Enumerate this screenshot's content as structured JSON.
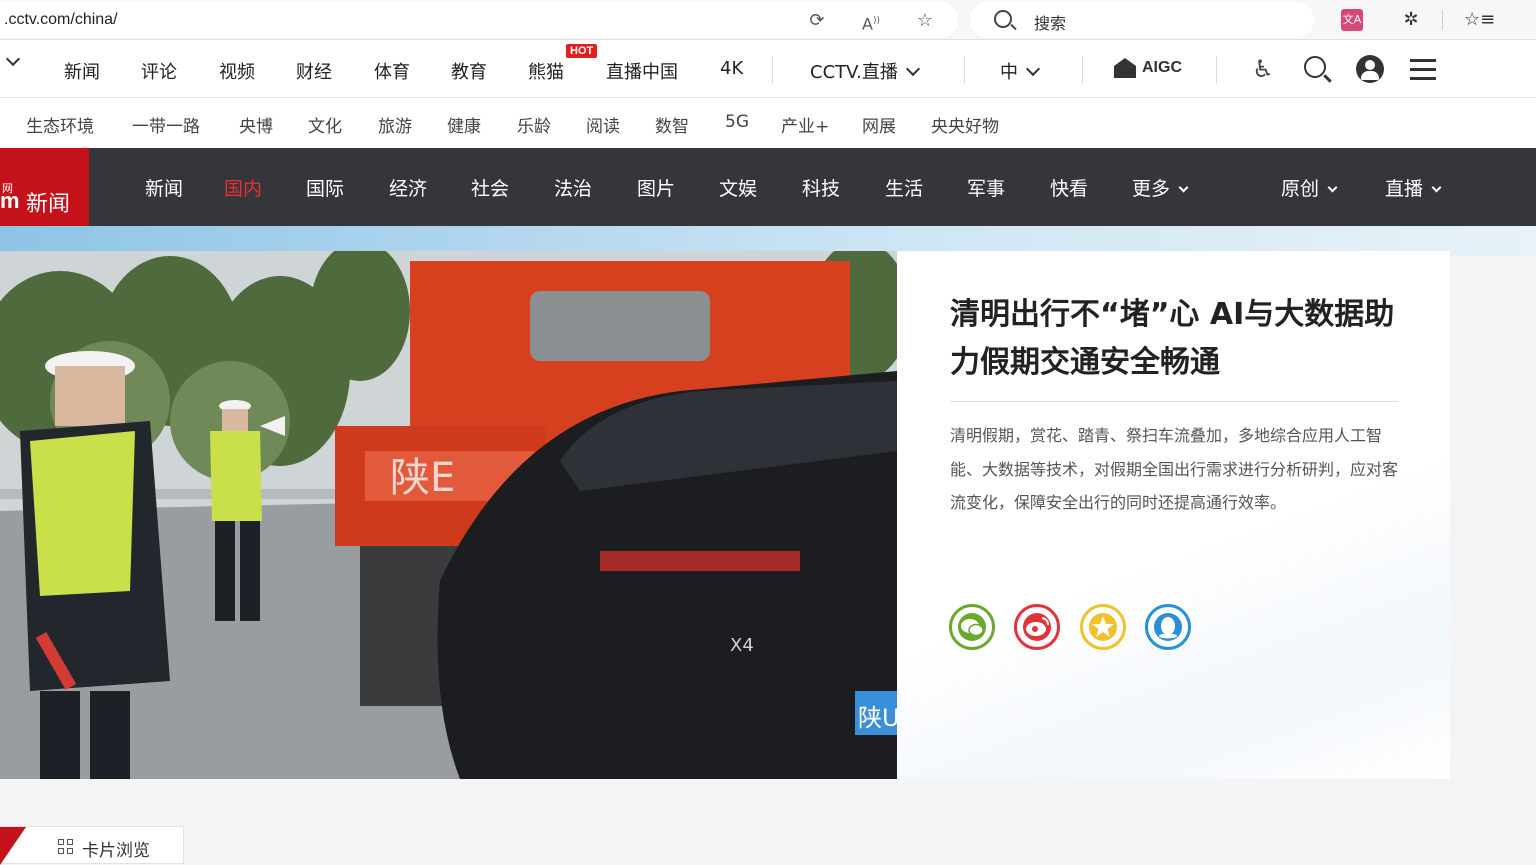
{
  "browser": {
    "url": ".cctv.com/china/",
    "search_placeholder": "搜索",
    "translate_icon_text": "文A"
  },
  "top_nav": {
    "items": [
      "新闻",
      "评论",
      "视频",
      "财经",
      "体育",
      "教育",
      "熊猫",
      "直播中国",
      "4K"
    ],
    "hot_badge": "HOT",
    "cctv_live": "CCTV.直播",
    "language": "中",
    "aigc": "AIGC"
  },
  "sub_nav": {
    "items": [
      "生态环境",
      "一带一路",
      "央博",
      "文化",
      "旅游",
      "健康",
      "乐龄",
      "阅读",
      "数智",
      "5G",
      "产业+",
      "网展",
      "央央好物"
    ]
  },
  "channel": {
    "brand_small": "网",
    "brand_m": "m",
    "brand_name": "新闻",
    "items": [
      "新闻",
      "国内",
      "国际",
      "经济",
      "社会",
      "法治",
      "图片",
      "文娱",
      "科技",
      "生活",
      "军事",
      "快看"
    ],
    "active": "国内",
    "more": "更多",
    "original": "原创",
    "live": "直播"
  },
  "hero": {
    "headline": "清明出行不“堵”心 AI与大数据助力假期交通安全畅通",
    "summary": "清明假期，赏花、踏青、祭扫车流叠加，多地综合应用人工智能、大数据等技术，对假期全国出行需求进行分析研判，应对客流变化，保障安全出行的同时还提高通行效率。",
    "share_icons": [
      "wechat-icon",
      "weibo-icon",
      "favorite-icon",
      "qq-icon"
    ],
    "share_colors": [
      "#6aa82f",
      "#e0343b",
      "#f1c12e",
      "#2b8fd6"
    ],
    "truck_plate": "陕E",
    "car_model": "X4",
    "car_plate": "陕U"
  },
  "footer": {
    "card_view_label": "卡片浏览"
  }
}
